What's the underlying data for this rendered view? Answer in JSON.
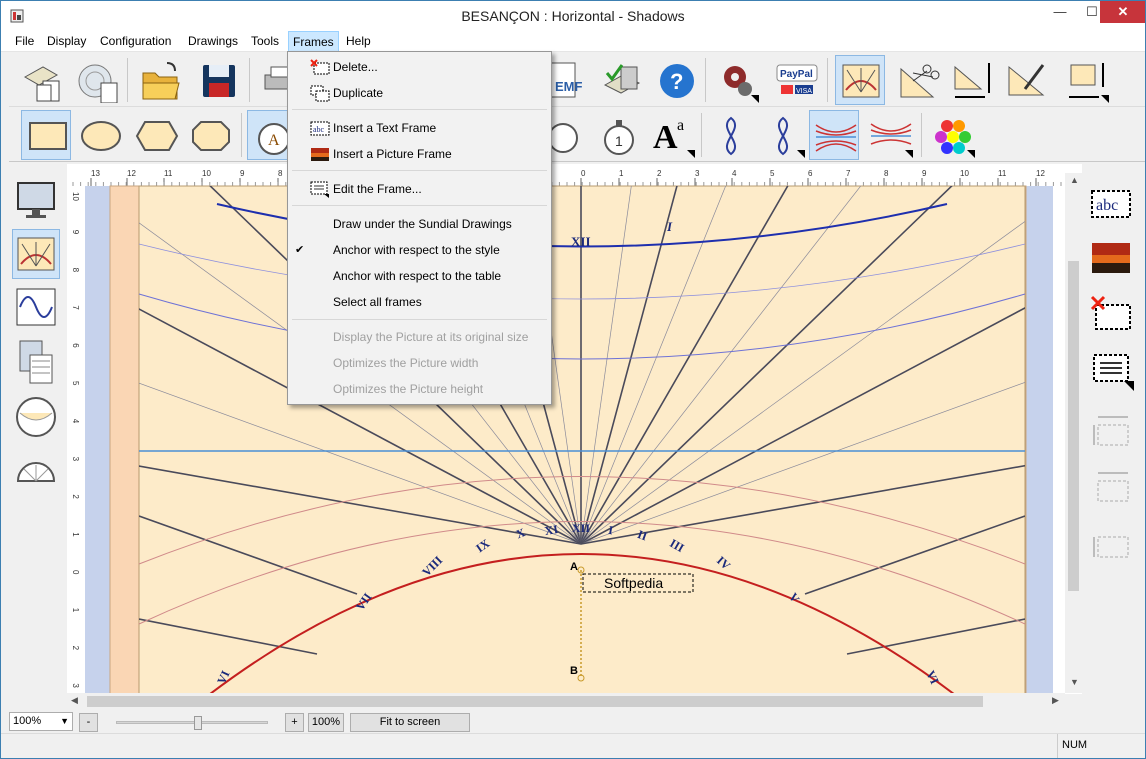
{
  "window": {
    "title": "BESANÇON : Horizontal - Shadows",
    "minimize": "—",
    "maximize": "☐",
    "close": "✕"
  },
  "menubar": [
    "File",
    "Display",
    "Configuration",
    "Drawings",
    "Tools",
    "Frames",
    "Help"
  ],
  "frames_menu": {
    "items": [
      {
        "label": "Delete...",
        "icon": "delete-frame-icon"
      },
      {
        "label": "Duplicate",
        "icon": "duplicate-frame-icon"
      },
      {
        "label": "Insert a Text Frame",
        "icon": "text-frame-icon"
      },
      {
        "label": "Insert a Picture Frame",
        "icon": "picture-frame-icon"
      },
      {
        "label": "Edit the Frame...",
        "icon": "edit-frame-icon"
      },
      {
        "label": "Draw under the Sundial Drawings"
      },
      {
        "label": "Anchor with respect to the style",
        "checked": true
      },
      {
        "label": "Anchor with respect to the table"
      },
      {
        "label": "Select all frames"
      },
      {
        "label": "Display the Picture at its original size",
        "disabled": true
      },
      {
        "label": "Optimizes the Picture width",
        "disabled": true
      },
      {
        "label": "Optimizes the Picture height",
        "disabled": true
      }
    ]
  },
  "toolbar_labels": {
    "paypal": "PayPal",
    "visa": "VISA",
    "emf": "EMF",
    "font_a": "A",
    "font_a_sup": "a"
  },
  "ruler": {
    "top": [
      "13",
      "12",
      "11",
      "10",
      "9",
      "8",
      "0",
      "1",
      "2",
      "3",
      "4",
      "5",
      "6",
      "7",
      "8",
      "9",
      "10",
      "11",
      "12"
    ],
    "left": [
      "10",
      "9",
      "8",
      "7",
      "6",
      "5",
      "4",
      "3",
      "2",
      "1",
      "0",
      "1",
      "2",
      "3"
    ]
  },
  "sundial": {
    "top_arc_labels": [
      "XII",
      "I"
    ],
    "hour_labels": [
      "VI",
      "VII",
      "VIII",
      "IX",
      "X",
      "XI",
      "XII",
      "I",
      "II",
      "III",
      "IV",
      "V",
      "VI"
    ],
    "text_frame": "Softpedia",
    "point_a": "A",
    "point_b": "B"
  },
  "bottom": {
    "zoom_value": "100%",
    "minus": "-",
    "plus": "+",
    "zoom_reset": "100%",
    "fit_to_screen": "Fit to screen"
  },
  "status": {
    "num": "NUM"
  }
}
